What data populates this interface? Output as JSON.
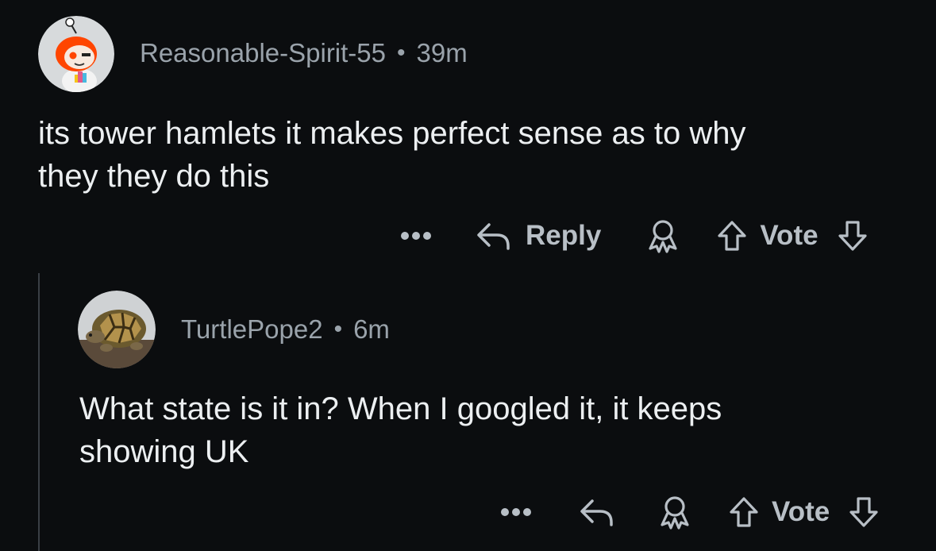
{
  "comments": [
    {
      "username": "Reasonable-Spirit-55",
      "separator": "•",
      "time": "39m",
      "text_line1": "its tower hamlets it makes perfect sense as to why",
      "text_line2": "they they do this",
      "reply_label": "Reply",
      "vote_label": "Vote"
    },
    {
      "username": "TurtlePope2",
      "separator": "•",
      "time": "6m",
      "text_line1": "What state is it in? When I googled it, it keeps",
      "text_line2": "showing UK",
      "vote_label": "Vote"
    }
  ],
  "icons": {
    "more": "more-options-icon",
    "reply": "reply-arrow-icon",
    "award": "award-icon",
    "upvote": "upvote-arrow-icon",
    "downvote": "downvote-arrow-icon"
  },
  "colors": {
    "background": "#0b0d0f",
    "meta_text": "#9aa3ab",
    "body_text": "#eceff1",
    "action_text": "#b8bfc6",
    "thread_line": "#3a3f45",
    "snoo_orange": "#ff4500"
  }
}
